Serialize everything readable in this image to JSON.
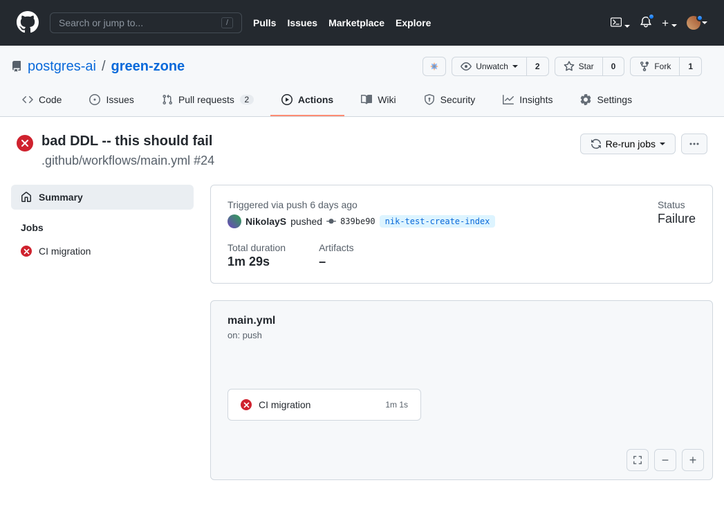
{
  "header": {
    "search_placeholder": "Search or jump to...",
    "search_key": "/",
    "nav": {
      "pulls": "Pulls",
      "issues": "Issues",
      "marketplace": "Marketplace",
      "explore": "Explore"
    }
  },
  "repo": {
    "owner": "postgres-ai",
    "name": "green-zone",
    "sep": "/",
    "actions": {
      "unwatch": "Unwatch",
      "unwatch_count": "2",
      "star": "Star",
      "star_count": "0",
      "fork": "Fork",
      "fork_count": "1"
    }
  },
  "tabs": {
    "code": "Code",
    "issues": "Issues",
    "pulls": "Pull requests",
    "pulls_count": "2",
    "actions": "Actions",
    "wiki": "Wiki",
    "security": "Security",
    "insights": "Insights",
    "settings": "Settings"
  },
  "run": {
    "title": "bad DDL -- this should fail",
    "subtitle": ".github/workflows/main.yml #24",
    "rerun": "Re-run jobs"
  },
  "sidebar": {
    "summary": "Summary",
    "jobs_head": "Jobs",
    "job1": "CI migration"
  },
  "summary": {
    "trigger_label": "Triggered via push 6 days ago",
    "user": "NikolayS",
    "pushed": "pushed",
    "sha": "839be90",
    "branch": "nik-test-create-index",
    "status_label": "Status",
    "status_val": "Failure",
    "duration_label": "Total duration",
    "duration_val": "1m 29s",
    "artifacts_label": "Artifacts",
    "artifacts_val": "–"
  },
  "graph": {
    "title": "main.yml",
    "on": "on: push",
    "job_name": "CI migration",
    "job_time": "1m 1s"
  }
}
